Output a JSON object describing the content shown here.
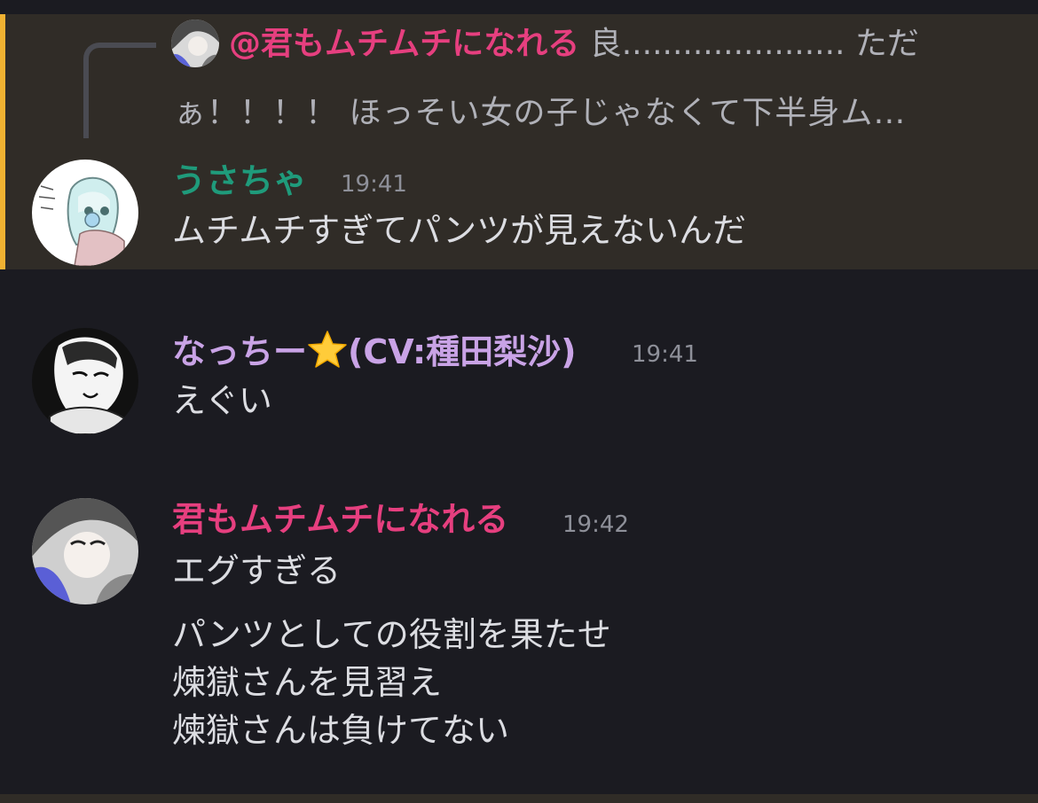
{
  "reply": {
    "mention": "@君もムチムチになれる",
    "preview_line1": "良...................... ただ",
    "preview_line2": "ぁ！！！！ ほっそい女の子じゃなくて下半身ム…"
  },
  "messages": [
    {
      "username": "うさちゃ",
      "username_color": "#1f9b7b",
      "time": "19:41",
      "lines": [
        "ムチムチすぎてパンツが見えないんだ"
      ],
      "highlighted": true
    },
    {
      "username": "なっちー",
      "username_suffix": "(CV:種田梨沙)",
      "username_color": "#c9a3e6",
      "emoji": "star",
      "time": "19:41",
      "lines": [
        "えぐい"
      ]
    },
    {
      "username": "君もムチムチになれる",
      "username_color": "#e63f7f",
      "time": "19:42",
      "lines": [
        "エグすぎる",
        "パンツとしての役割を果たせ",
        "煉獄さんを見習え",
        "煉獄さんは負けてない"
      ]
    }
  ],
  "colors": {
    "background": "#1b1b21",
    "highlight_background": "#302c27",
    "highlight_accent": "#f0b232",
    "text": "#dcdde2",
    "muted": "#8e9099"
  }
}
